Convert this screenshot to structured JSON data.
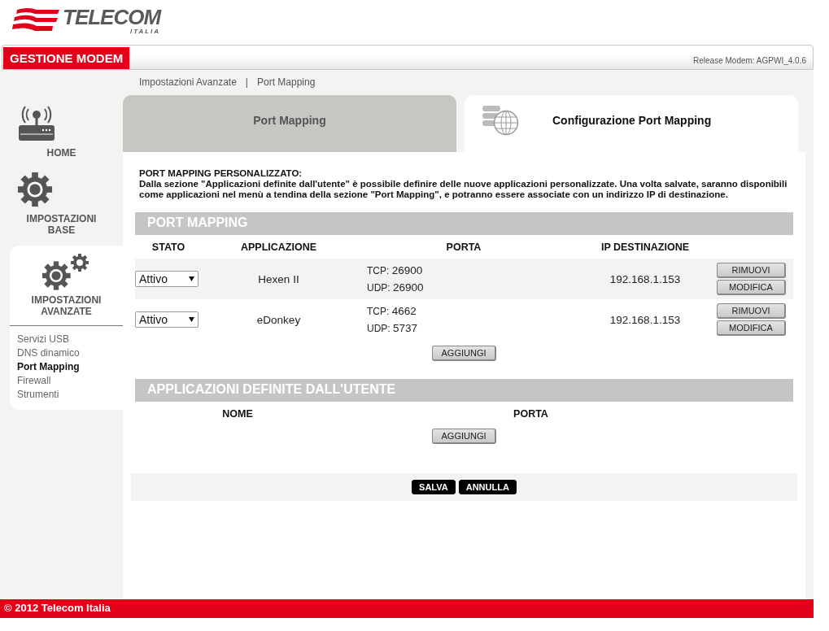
{
  "logo": {
    "name": "TELECOM",
    "sub": "ITALIA"
  },
  "header": {
    "title": "GESTIONE MODEM",
    "release": "Release Modem: AGPWI_4.0.6"
  },
  "breadcrumb": {
    "items": [
      "Impostazioni Avanzate",
      "Port Mapping"
    ],
    "separator": "|"
  },
  "sidebar": {
    "sections": [
      {
        "kind": "home",
        "label": "HOME",
        "selected": false
      },
      {
        "kind": "base",
        "label": "IMPOSTAZIONI BASE",
        "selected": false
      },
      {
        "kind": "advanced",
        "label": "IMPOSTAZIONI AVANZATE",
        "selected": true
      }
    ],
    "items": [
      {
        "label": "Servizi USB",
        "selected": false
      },
      {
        "label": "DNS dinamico",
        "selected": false
      },
      {
        "label": "Port Mapping",
        "selected": true
      },
      {
        "label": "Firewall",
        "selected": false
      },
      {
        "label": "Strumenti",
        "selected": false
      }
    ]
  },
  "tabs": [
    {
      "label": "Port Mapping",
      "selected": false
    },
    {
      "label": "Configurazione Port Mapping",
      "selected": true
    }
  ],
  "intro": {
    "title": "PORT MAPPING PERSONALIZZATO:",
    "text": "Dalla sezione \"Applicazioni definite dall'utente\" è possibile definire delle nuove applicazioni personalizzate. Una volta salvate, saranno disponibili come applicazioni nel menù a tendina della sezione \"Port Mapping\", e potranno essere associate con un indirizzo IP di destinazione."
  },
  "port_mapping": {
    "title": "PORT MAPPING",
    "columns": [
      "STATO",
      "APPLICAZIONE",
      "PORTA",
      "IP DESTINAZIONE"
    ],
    "rows": [
      {
        "stato": "Attivo",
        "applicazione": "Hexen II",
        "ports": [
          {
            "protocol": "TCP:",
            "number": "26900"
          },
          {
            "protocol": "UDP:",
            "number": "26900"
          }
        ],
        "ip": "192.168.1.153",
        "buttons": [
          "RIMUOVI",
          "MODIFICA"
        ]
      },
      {
        "stato": "Attivo",
        "applicazione": "eDonkey",
        "ports": [
          {
            "protocol": "TCP:",
            "number": "4662"
          },
          {
            "protocol": "UDP:",
            "number": "5737"
          }
        ],
        "ip": "192.168.1.153",
        "buttons": [
          "RIMUOVI",
          "MODIFICA"
        ]
      }
    ],
    "add_button": "AGGIUNGI"
  },
  "user_apps": {
    "title": "APPLICAZIONI DEFINITE DALL'UTENTE",
    "columns": [
      "NOME",
      "PORTA"
    ],
    "add_button": "AGGIUNGI"
  },
  "actions": [
    "SALVA",
    "ANNULLA"
  ],
  "footer": "© 2012 Telecom Italia"
}
